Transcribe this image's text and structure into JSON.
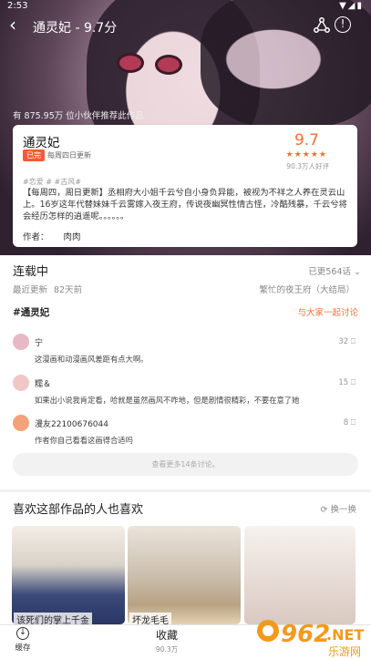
{
  "status": {
    "time": "2:53",
    "system_icons": "▼◢▮"
  },
  "header": {
    "title": "通灵妃 - 9.7分"
  },
  "heat": {
    "text": "有 875.95万 位小伙伴推荐此作品"
  },
  "book": {
    "title": "通灵妃",
    "tag": "已完",
    "update_schedule": "每周四日更新",
    "score": "9.7",
    "stars": "★★★★★",
    "rating_count": "90.3万人好评",
    "genres": "#恋爱 # #古风#",
    "description": "【每周四，周日更新】丞相府大小姐千云兮自小身负异能，被视为不祥之人养在灵云山上。16岁这年代替妹妹千云雾嫁入夜王府，传说夜幽冥性情古怪，冷酷残暴，千云兮将会经历怎样的逍遥呢。。。。。。",
    "author_label": "作者：",
    "author": "肉肉"
  },
  "chapters": {
    "status": "连载中",
    "count_label": "已更564话",
    "recent_label": "最近更新",
    "recent_time": "82天前",
    "latest_title": "繁忙的夜王府（大结局）"
  },
  "discussion": {
    "hashtag": "#通灵妃",
    "join_label": "与大家一起讨论",
    "comments": [
      {
        "user": "宁",
        "text": "这漫画和动漫画风差距有点大啊。",
        "likes": "32"
      },
      {
        "user": "糯＆",
        "text": "如果出小说我肯定看，哈就是虽然画风不咋地，但是剧情很精彩，不要在意了她",
        "likes": "15"
      },
      {
        "user": "漫友22100676044",
        "text": "作者你自己看看这画得合适吗",
        "likes": "8"
      }
    ],
    "more_label": "查看更多14条讨论。"
  },
  "recommendations": {
    "title": "喜欢这部作品的人也喜欢",
    "shuffle_label": "换一换",
    "items": [
      {
        "name": "该死们的掌上千金"
      },
      {
        "name": "坏龙毛毛"
      },
      {
        "name": ""
      }
    ]
  },
  "bottom": {
    "cache_label": "缓存",
    "fav_label": "收藏",
    "fav_count": "90.3万"
  },
  "watermark": {
    "brand": "962",
    "suffix": ".NET",
    "cn": "乐游网"
  },
  "colors": {
    "accent": "#f1703a",
    "tag_red": "#f25b3a"
  }
}
